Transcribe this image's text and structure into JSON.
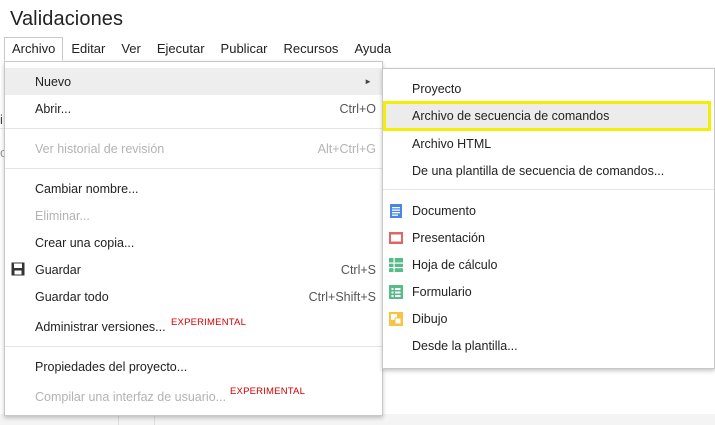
{
  "title": "Validaciones",
  "menubar": [
    "Archivo",
    "Editar",
    "Ver",
    "Ejecutar",
    "Publicar",
    "Recursos",
    "Ayuda"
  ],
  "background": {
    "left_char": "i",
    "left_char2": "o"
  },
  "file_menu": {
    "nuevo": "Nuevo",
    "abrir": {
      "label": "Abrir...",
      "shortcut": "Ctrl+O"
    },
    "historial": {
      "label": "Ver historial de revisión",
      "shortcut": "Alt+Ctrl+G"
    },
    "cambiar_nombre": "Cambiar nombre...",
    "eliminar": "Eliminar...",
    "crear_copia": "Crear una copia...",
    "guardar": {
      "label": "Guardar",
      "shortcut": "Ctrl+S"
    },
    "guardar_todo": {
      "label": "Guardar todo",
      "shortcut": "Ctrl+Shift+S"
    },
    "administrar": {
      "label": "Administrar versiones...",
      "badge": "EXPERIMENTAL"
    },
    "propiedades": "Propiedades del proyecto...",
    "compilar": {
      "label": "Compilar una interfaz de usuario...",
      "badge": "EXPERIMENTAL"
    }
  },
  "submenu": {
    "proyecto": "Proyecto",
    "archivo_secuencia": "Archivo de secuencia de comandos",
    "archivo_html": "Archivo HTML",
    "plantilla_secuencia": "De una plantilla de secuencia de comandos...",
    "documento": "Documento",
    "presentacion": "Presentación",
    "hoja": "Hoja de cálculo",
    "formulario": "Formulario",
    "dibujo": "Dibujo",
    "desde_plantilla": "Desde la plantilla..."
  },
  "colors": {
    "highlight_outline": "#f5ee00",
    "experimental": "#d40000",
    "docs": "#4a86e8",
    "slides": "#e06666",
    "sheets": "#57bb8a",
    "forms": "#57bb8a",
    "drawings": "#f6c342"
  }
}
